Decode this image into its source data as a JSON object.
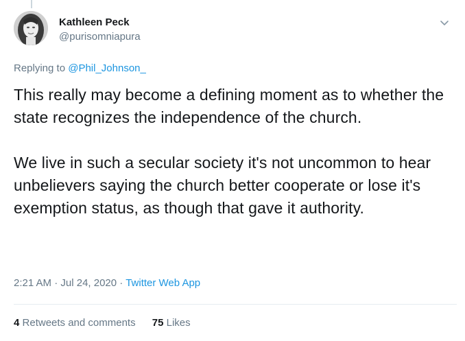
{
  "author": {
    "display_name": "Kathleen Peck",
    "handle": "@purisomniapura"
  },
  "reply": {
    "prefix": "Replying to",
    "target": "@Phil_Johnson_"
  },
  "tweet": {
    "paragraphs": [
      "This really may become a defining moment as to whether the state recognizes the independence of the church.",
      "We live in such a secular society it's not uncommon to hear unbelievers saying the church better cooperate or lose it's exemption status, as though that gave it authority."
    ],
    "time": "2:21 AM",
    "date": "Jul 24, 2020",
    "separator": "·",
    "source": "Twitter Web App"
  },
  "stats": {
    "retweets_count": "4",
    "retweets_label": "Retweets and comments",
    "likes_count": "75",
    "likes_label": "Likes"
  },
  "icons": {
    "caret": "chevron-down-icon",
    "avatar": "profile-photo"
  },
  "colors": {
    "link": "#1b95e0",
    "muted": "#657786",
    "text": "#14171a",
    "divider": "#e6ecf0"
  }
}
